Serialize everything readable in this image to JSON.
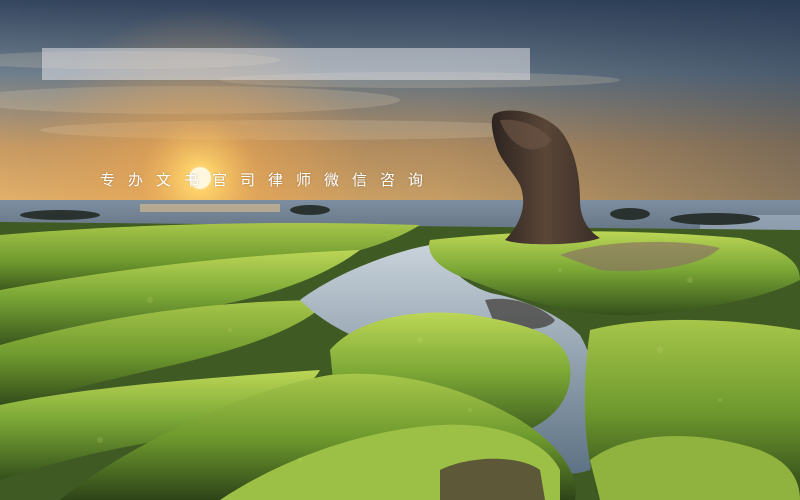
{
  "overlay": {
    "caption": "专办文书官司律师微信咨询",
    "bar_color": "#e1e1e6"
  },
  "scene": {
    "sky_top": "#3d4f6c",
    "sun": "#ffd36a",
    "moss": "#7aa23a",
    "water": "#8aa1b5",
    "rock": "#3a2e28"
  }
}
